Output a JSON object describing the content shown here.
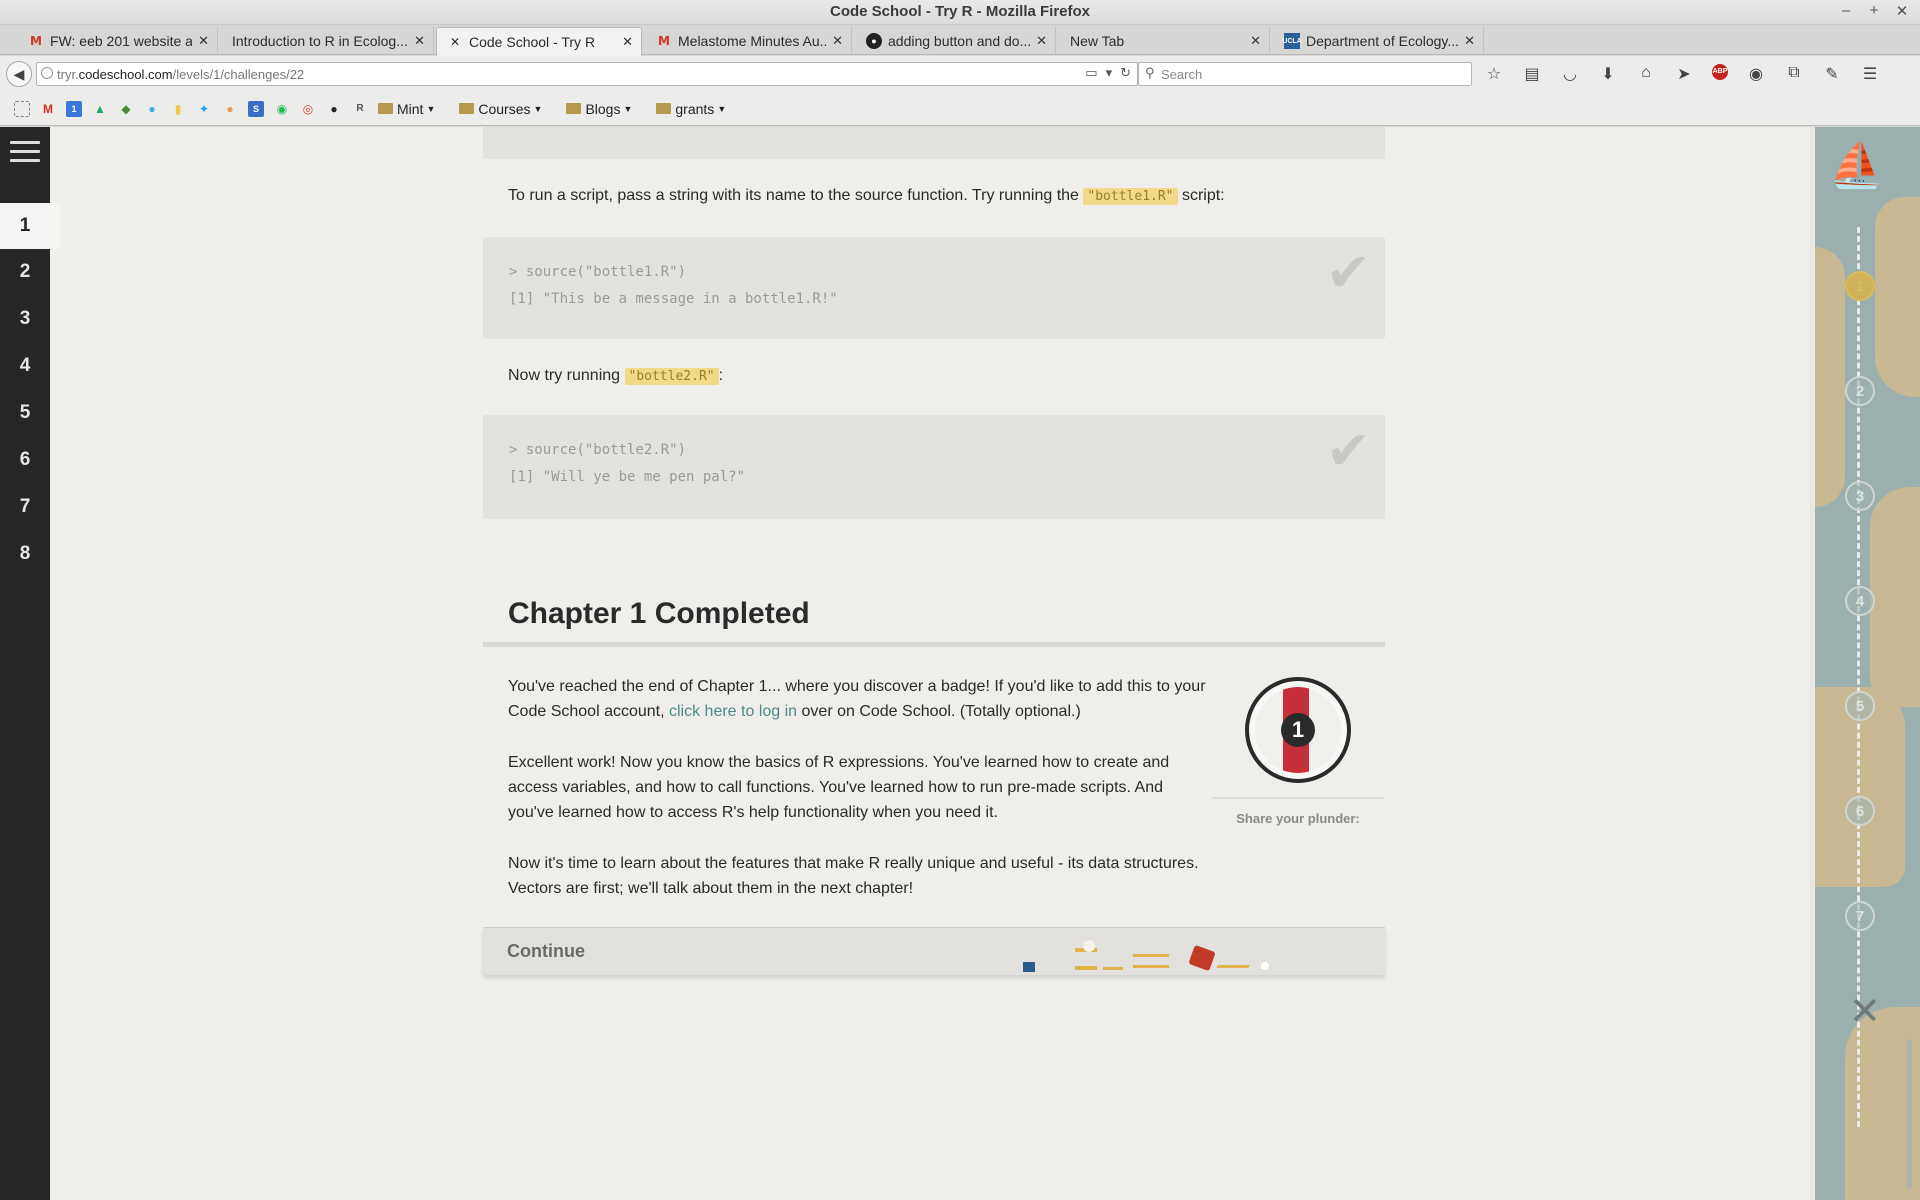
{
  "window": {
    "title": "Code School - Try R - Mozilla Firefox",
    "controls": [
      "–",
      "+",
      "✕"
    ]
  },
  "tabs": [
    {
      "label": "FW: eeb 201 website a...",
      "favicon": "gmail-icon",
      "active": false
    },
    {
      "label": "Introduction to R in Ecolog...",
      "favicon": "",
      "active": false
    },
    {
      "label": "Code School - Try R",
      "favicon": "codeschool-icon",
      "active": true
    },
    {
      "label": "Melastome Minutes Au...",
      "favicon": "gmail-icon",
      "active": false
    },
    {
      "label": "adding button and do...",
      "favicon": "github-icon",
      "active": false
    },
    {
      "label": "New Tab",
      "favicon": "",
      "active": false
    },
    {
      "label": "Department of Ecology...",
      "favicon": "ucla-icon",
      "active": false
    }
  ],
  "tab_close": "✕",
  "new_tab": "✚",
  "nav": {
    "url_prefix": "tryr.",
    "url_host": "codeschool.com",
    "url_path": "/levels/1/challenges/22",
    "search_placeholder": "Search"
  },
  "bookmarks": {
    "folders": [
      "Mint",
      "Courses",
      "Blogs",
      "grants"
    ]
  },
  "sidebar": {
    "chapters": [
      "1",
      "2",
      "3",
      "4",
      "5",
      "6",
      "7",
      "8"
    ],
    "active": "1"
  },
  "lesson": {
    "run_script_text": "To run a script, pass a string with its name to the source function. Try running the",
    "run_script_code": "\"bottle1.R\"",
    "run_script_tail": "script:",
    "code1_line1": "> source(\"bottle1.R\")",
    "code1_line2": "[1] \"This be a message in a bottle1.R!\"",
    "try2_text": "Now try running",
    "try2_code": "\"bottle2.R\"",
    "try2_tail": ":",
    "code2_line1": "> source(\"bottle2.R\")",
    "code2_line2": "[1] \"Will ye be me pen pal?\"",
    "chapter_heading": "Chapter 1 Completed",
    "p1_a": "You've reached the end of Chapter 1... where you discover a badge! If you'd like to add this to your Code School account,",
    "p1_link": "click here to log in",
    "p1_b": "over on Code School. (Totally optional.)",
    "p2": "Excellent work! Now you know the basics of R expressions. You've learned how to create and access variables, and how to call functions. You've learned how to run pre-made scripts. And you've learned how to access R's help functionality when you need it.",
    "p3": "Now it's time to learn about the features that make R really unique and useful - its data structures. Vectors are first; we'll talk about them in the next chapter!",
    "badge_number": "1",
    "share_label": "Share your plunder:",
    "continue_label": "Continue"
  },
  "map": {
    "waypoints": [
      "1",
      "2",
      "3",
      "4",
      "5",
      "6",
      "7"
    ],
    "completed": [
      "1"
    ]
  },
  "colors": {
    "highlight_code_bg": "#f1d98a",
    "link": "#4e8a8c",
    "sidebar": "#262626",
    "badge_red": "#c82e38"
  }
}
